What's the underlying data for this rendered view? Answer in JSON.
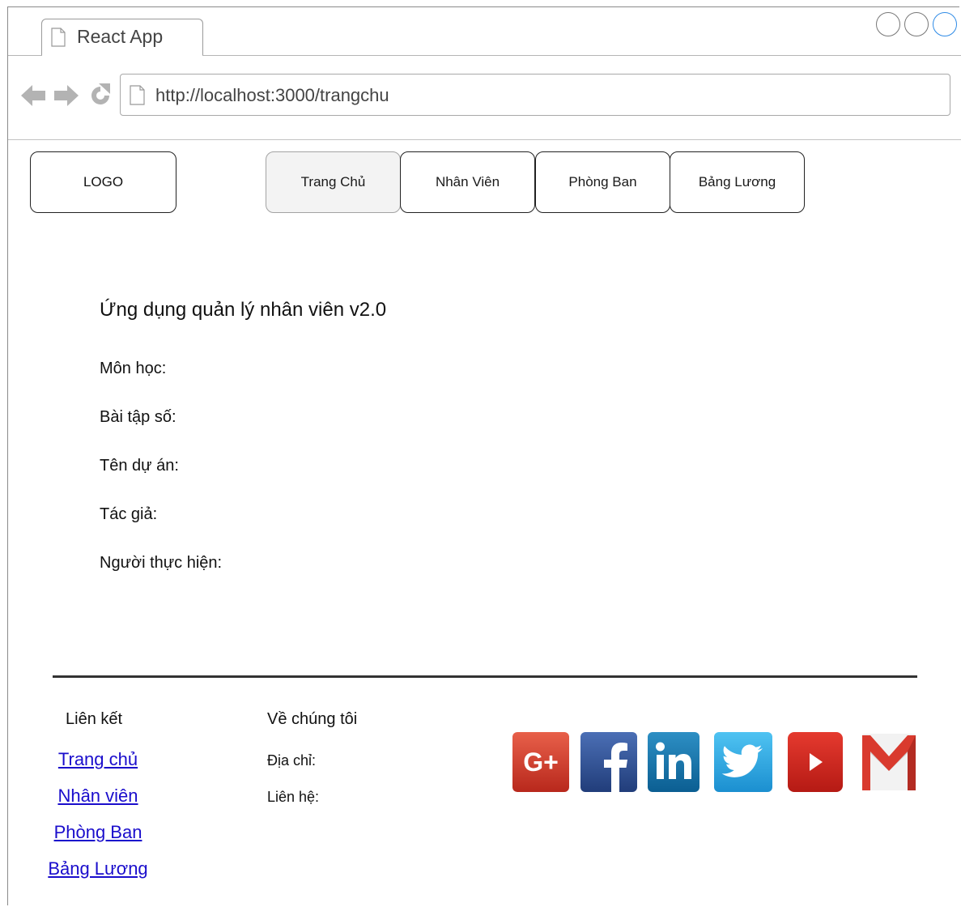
{
  "browser": {
    "tab_title": "React App",
    "url": "http://localhost:3000/trangchu"
  },
  "header": {
    "logo": "LOGO",
    "nav": [
      {
        "label": "Trang Chủ",
        "active": true
      },
      {
        "label": "Nhân Viên",
        "active": false
      },
      {
        "label": "Phòng Ban",
        "active": false
      },
      {
        "label": "Bảng Lương",
        "active": false
      }
    ]
  },
  "main": {
    "title": "Ứng dụng quản lý nhân viên v2.0",
    "fields": [
      "Môn học:",
      "Bài tập số:",
      "Tên dự án:",
      "Tác giả:",
      "Người thực hiện:"
    ]
  },
  "footer": {
    "links_title": "Liên kết",
    "links": [
      "Trang chủ",
      "Nhân viên",
      "Phòng Ban",
      "Bảng Lương"
    ],
    "about_title": "Về chúng tôi",
    "about": [
      "Địa chỉ:",
      "Liên hệ:"
    ],
    "social_icons": [
      "google-plus-icon",
      "facebook-icon",
      "linkedin-icon",
      "twitter-icon",
      "youtube-icon",
      "gmail-icon"
    ]
  },
  "colors": {
    "link": "#1a0dcc",
    "active_tab_bg": "#f3f3f3"
  }
}
